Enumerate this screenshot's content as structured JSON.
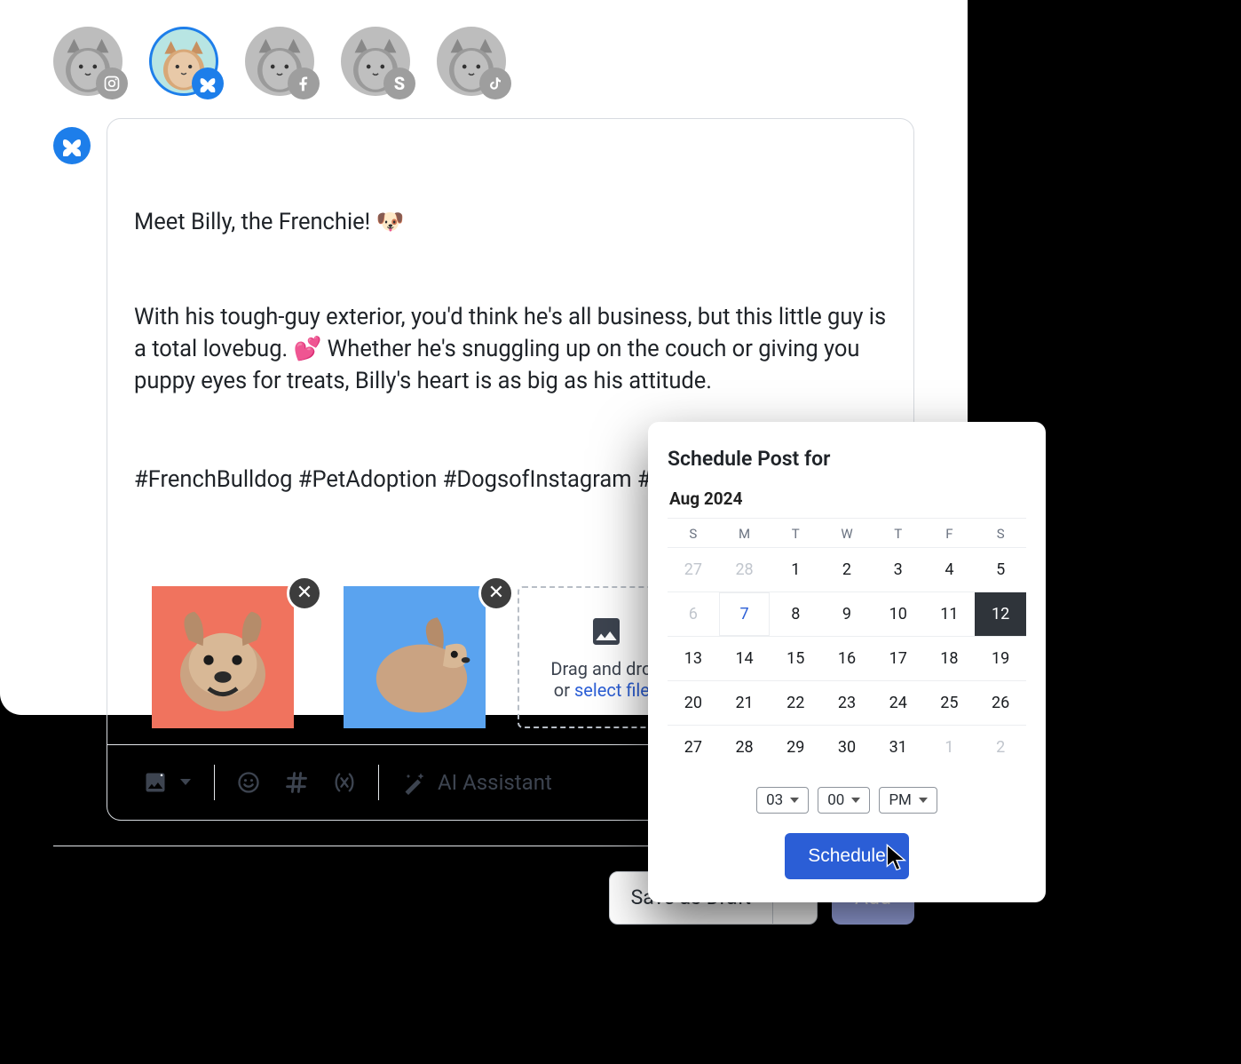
{
  "accounts": [
    {
      "platform": "instagram",
      "selected": false
    },
    {
      "platform": "bluesky",
      "selected": true
    },
    {
      "platform": "facebook",
      "selected": false
    },
    {
      "platform": "spoutible",
      "selected": false
    },
    {
      "platform": "tiktok",
      "selected": false
    }
  ],
  "composer": {
    "active_platform": "bluesky",
    "text_line1": "Meet Billy, the Frenchie! 🐶",
    "text_body": "With his tough-guy exterior, you'd think he's all business, but this little guy is a total lovebug. 💕 Whether he's snuggling up on the couch or giving you puppy eyes for treats, Billy's heart is as big as his attitude.",
    "hashtags": "#FrenchBulldog #PetAdoption #DogsofInstagram #DogRescue",
    "media": [
      {
        "alt": "French bulldog front view",
        "bg": "#f0735e"
      },
      {
        "alt": "French bulldog side view",
        "bg": "#5aa3ef"
      }
    ],
    "dropzone_line1": "Drag and drop",
    "dropzone_or": "or ",
    "dropzone_link": "select files"
  },
  "toolbar": {
    "ai_label": "AI Assistant"
  },
  "actions": {
    "save_draft": "Save as Draft",
    "add": "Add"
  },
  "schedule": {
    "title": "Schedule Post for",
    "month_label": "Aug 2024",
    "dow": [
      "S",
      "M",
      "T",
      "W",
      "T",
      "F",
      "S"
    ],
    "days": [
      {
        "n": "27",
        "outside": true
      },
      {
        "n": "28",
        "outside": true
      },
      {
        "n": "1"
      },
      {
        "n": "2"
      },
      {
        "n": "3"
      },
      {
        "n": "4"
      },
      {
        "n": "5"
      },
      {
        "n": "6",
        "outside": true
      },
      {
        "n": "7",
        "today": true
      },
      {
        "n": "8"
      },
      {
        "n": "9"
      },
      {
        "n": "10"
      },
      {
        "n": "11"
      },
      {
        "n": "12",
        "selected": true
      },
      {
        "n": "13"
      },
      {
        "n": "14"
      },
      {
        "n": "15"
      },
      {
        "n": "16"
      },
      {
        "n": "17"
      },
      {
        "n": "18"
      },
      {
        "n": "19"
      },
      {
        "n": "20"
      },
      {
        "n": "21"
      },
      {
        "n": "22"
      },
      {
        "n": "23"
      },
      {
        "n": "24"
      },
      {
        "n": "25"
      },
      {
        "n": "26"
      },
      {
        "n": "27"
      },
      {
        "n": "28"
      },
      {
        "n": "29"
      },
      {
        "n": "30"
      },
      {
        "n": "31"
      },
      {
        "n": "1",
        "outside": true
      },
      {
        "n": "2",
        "outside": true
      }
    ],
    "hour": "03",
    "minute": "00",
    "ampm": "PM",
    "button": "Schedule"
  }
}
